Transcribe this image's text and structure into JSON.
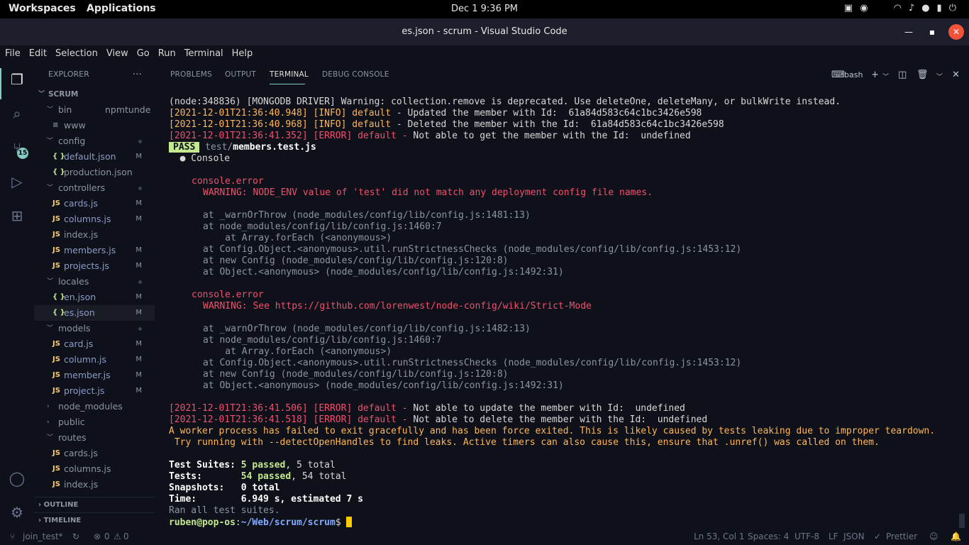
{
  "system": {
    "workspaces": "Workspaces",
    "applications": "Applications",
    "clock": "Dec 1   9:36 PM"
  },
  "window": {
    "title": "es.json - scrum - Visual Studio Code"
  },
  "menu": [
    "File",
    "Edit",
    "Selection",
    "View",
    "Go",
    "Run",
    "Terminal",
    "Help"
  ],
  "activity": {
    "scm_badge": "15"
  },
  "explorer": {
    "header": "EXPLORER",
    "more": "···",
    "root": "SCRUM",
    "tooltip": "npmtunde",
    "items": [
      {
        "label": "bin",
        "type": "folder",
        "open": true,
        "depth": 1
      },
      {
        "label": "www",
        "type": "file",
        "depth": 2
      },
      {
        "label": "config",
        "type": "folder",
        "open": true,
        "depth": 1,
        "dot": true
      },
      {
        "label": "default.json",
        "type": "json",
        "depth": 2,
        "m": "M"
      },
      {
        "label": "production.json",
        "type": "json",
        "depth": 2
      },
      {
        "label": "controllers",
        "type": "folder",
        "open": true,
        "depth": 1,
        "dot": true
      },
      {
        "label": "cards.js",
        "type": "js",
        "depth": 2,
        "m": "M"
      },
      {
        "label": "columns.js",
        "type": "js",
        "depth": 2,
        "m": "M"
      },
      {
        "label": "index.js",
        "type": "js",
        "depth": 2
      },
      {
        "label": "members.js",
        "type": "js",
        "depth": 2,
        "m": "M"
      },
      {
        "label": "projects.js",
        "type": "js",
        "depth": 2,
        "m": "M"
      },
      {
        "label": "locales",
        "type": "folder",
        "open": true,
        "depth": 1,
        "dot": true
      },
      {
        "label": "en.json",
        "type": "json",
        "depth": 2,
        "m": "M"
      },
      {
        "label": "es.json",
        "type": "json",
        "depth": 2,
        "m": "M",
        "selected": true
      },
      {
        "label": "models",
        "type": "folder",
        "open": true,
        "depth": 1,
        "dot": true
      },
      {
        "label": "card.js",
        "type": "js",
        "depth": 2,
        "m": "M"
      },
      {
        "label": "column.js",
        "type": "js",
        "depth": 2,
        "m": "M"
      },
      {
        "label": "member.js",
        "type": "js",
        "depth": 2,
        "m": "M"
      },
      {
        "label": "project.js",
        "type": "js",
        "depth": 2,
        "m": "M"
      },
      {
        "label": "node_modules",
        "type": "folder",
        "open": false,
        "depth": 1
      },
      {
        "label": "public",
        "type": "folder",
        "open": false,
        "depth": 1
      },
      {
        "label": "routes",
        "type": "folder",
        "open": true,
        "depth": 1
      },
      {
        "label": "cards.js",
        "type": "js",
        "depth": 2
      },
      {
        "label": "columns.js",
        "type": "js",
        "depth": 2
      },
      {
        "label": "index.js",
        "type": "js",
        "depth": 2
      }
    ],
    "outline": "OUTLINE",
    "timeline": "TIMELINE"
  },
  "panel": {
    "tabs": [
      "PROBLEMS",
      "OUTPUT",
      "TERMINAL",
      "DEBUG CONSOLE"
    ],
    "active_tab": "TERMINAL",
    "shell": "bash"
  },
  "terminal": {
    "l1": "(node:348836) [MONGODB DRIVER] Warning: collection.remove is deprecated. Use deleteOne, deleteMany, or bulkWrite instead.",
    "l2a": "[2021-12-01T21:36:40.948] [INFO] default",
    "l2b": " - Updated the member with Id:  61a84d583c64c1bc3426e598",
    "l3a": "[2021-12-01T21:36:40.968] [INFO] default",
    "l3b": " - Deleted the member with the Id:  61a84d583c64c1bc3426e598",
    "l4a": "[2021-12-01T21:36:41.352] [ERROR] default - ",
    "l4b": "Not able to get the member with the Id:  undefined",
    "pass": "PASS",
    "pass_path": "test/",
    "pass_file": "members.test.js",
    "console": "  ● Console",
    "ce": "console.error",
    "warn1": "WARNING: NODE_ENV value of 'test' did not match any deployment config file names.",
    "s1_1": "at _warnOrThrow (node_modules/config/lib/config.js:1481:13)",
    "s1_2": "at node_modules/config/lib/config.js:1460:7",
    "s1_3": "    at Array.forEach (<anonymous>)",
    "s1_4": "at Config.Object.<anonymous>.util.runStrictnessChecks (node_modules/config/lib/config.js:1453:12)",
    "s1_5": "at new Config (node_modules/config/lib/config.js:120:8)",
    "s1_6": "at Object.<anonymous> (node_modules/config/lib/config.js:1492:31)",
    "warn2": "WARNING: See https://github.com/lorenwest/node-config/wiki/Strict-Mode",
    "s2_1": "at _warnOrThrow (node_modules/config/lib/config.js:1482:13)",
    "s2_2": "at node_modules/config/lib/config.js:1460:7",
    "s2_3": "    at Array.forEach (<anonymous>)",
    "s2_4": "at Config.Object.<anonymous>.util.runStrictnessChecks (node_modules/config/lib/config.js:1453:12)",
    "s2_5": "at new Config (node_modules/config/lib/config.js:120:8)",
    "s2_6": "at Object.<anonymous> (node_modules/config/lib/config.js:1492:31)",
    "e1a": "[2021-12-01T21:36:41.506] [ERROR] default - ",
    "e1b": "Not able to update the member with Id:  undefined",
    "e2a": "[2021-12-01T21:36:41.518] [ERROR] default - ",
    "e2b": "Not able to delete the member with the Id:  undefined",
    "worker1": "A worker process has failed to exit gracefully and has been force exited. This is likely caused by tests leaking due to improper teardown.",
    "worker2": " Try running with --detectOpenHandles to find leaks. Active timers can also cause this, ensure that .unref() was called on them.",
    "suites_label": "Test Suites: ",
    "suites_passed": "5 passed",
    "suites_total": ", 5 total",
    "tests_label": "Tests:       ",
    "tests_passed": "54 passed",
    "tests_total": ", 54 total",
    "snap": "Snapshots:   0 total",
    "time": "Time:        6.949 s, estimated 7 s",
    "ran": "Ran all test suites.",
    "prompt_user": "ruben@pop-os",
    "prompt_path": "~/Web/scrum/scrum",
    "prompt_end": "$ "
  },
  "status": {
    "branch": "join_test*",
    "errors": "0",
    "warnings": "0",
    "position": "Ln 53, Col 1",
    "spaces": "Spaces: 4",
    "encoding": "UTF-8",
    "eol": "LF",
    "language": "JSON",
    "prettier": "Prettier"
  },
  "colors": {
    "accent": "#80cbc4",
    "error": "#f0506e",
    "warn": "#ffb657",
    "pass": "#c3e88d"
  }
}
